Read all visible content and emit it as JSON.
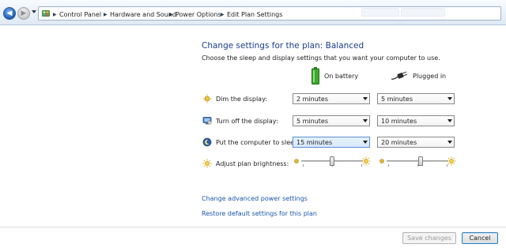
{
  "address_bar": {
    "breadcrumbs": [
      "Control Panel",
      "Hardware and Sound",
      "Power Options",
      "Edit Plan Settings"
    ]
  },
  "page": {
    "title": "Change settings for the plan: Balanced",
    "subtitle": "Choose the sleep and display settings that you want your computer to use."
  },
  "columns": {
    "on_battery": "On battery",
    "plugged_in": "Plugged in"
  },
  "settings": {
    "dim_display": {
      "label": "Dim the display:",
      "battery": "2 minutes",
      "plugged": "5 minutes"
    },
    "turn_off_display": {
      "label": "Turn off the display:",
      "battery": "5 minutes",
      "plugged": "10 minutes"
    },
    "sleep": {
      "label": "Put the computer to sleep:",
      "battery": "15 minutes",
      "plugged": "20 minutes"
    },
    "brightness": {
      "label": "Adjust plan brightness:",
      "battery_level": 0.5,
      "plugged_level": 0.55
    }
  },
  "links": {
    "advanced": "Change advanced power settings",
    "restore": "Restore default settings for this plan"
  },
  "buttons": {
    "save": "Save changes",
    "cancel": "Cancel"
  },
  "colors": {
    "title": "#1a3d8c",
    "link": "#1a56a8",
    "battery": "#3caa2d"
  }
}
